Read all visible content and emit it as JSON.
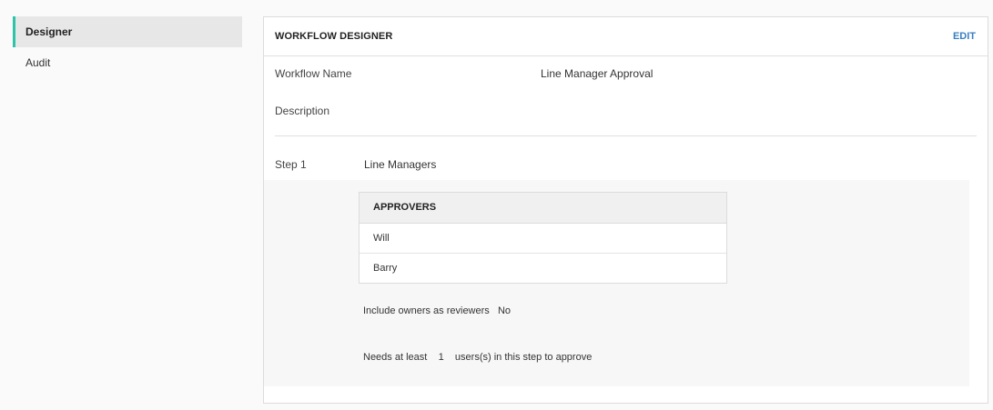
{
  "sidebar": {
    "items": [
      {
        "label": "Designer",
        "active": true
      },
      {
        "label": "Audit",
        "active": false
      }
    ],
    "accent_color": "#2ec4a9"
  },
  "card": {
    "title": "WORKFLOW DESIGNER",
    "edit_label": "EDIT",
    "edit_color": "#3a7fc1",
    "fields": {
      "workflow_name_label": "Workflow Name",
      "workflow_name_value": "Line Manager Approval",
      "description_label": "Description",
      "description_value": ""
    },
    "step": {
      "label": "Step 1",
      "name": "Line Managers",
      "approvers_header": "APPROVERS",
      "approvers": [
        "Will",
        "Barry"
      ],
      "include_owners_label": "Include owners as reviewers",
      "include_owners_value": "No",
      "needs_prefix": "Needs at least",
      "needs_count": "1",
      "needs_suffix": "users(s) in this step to approve"
    }
  }
}
